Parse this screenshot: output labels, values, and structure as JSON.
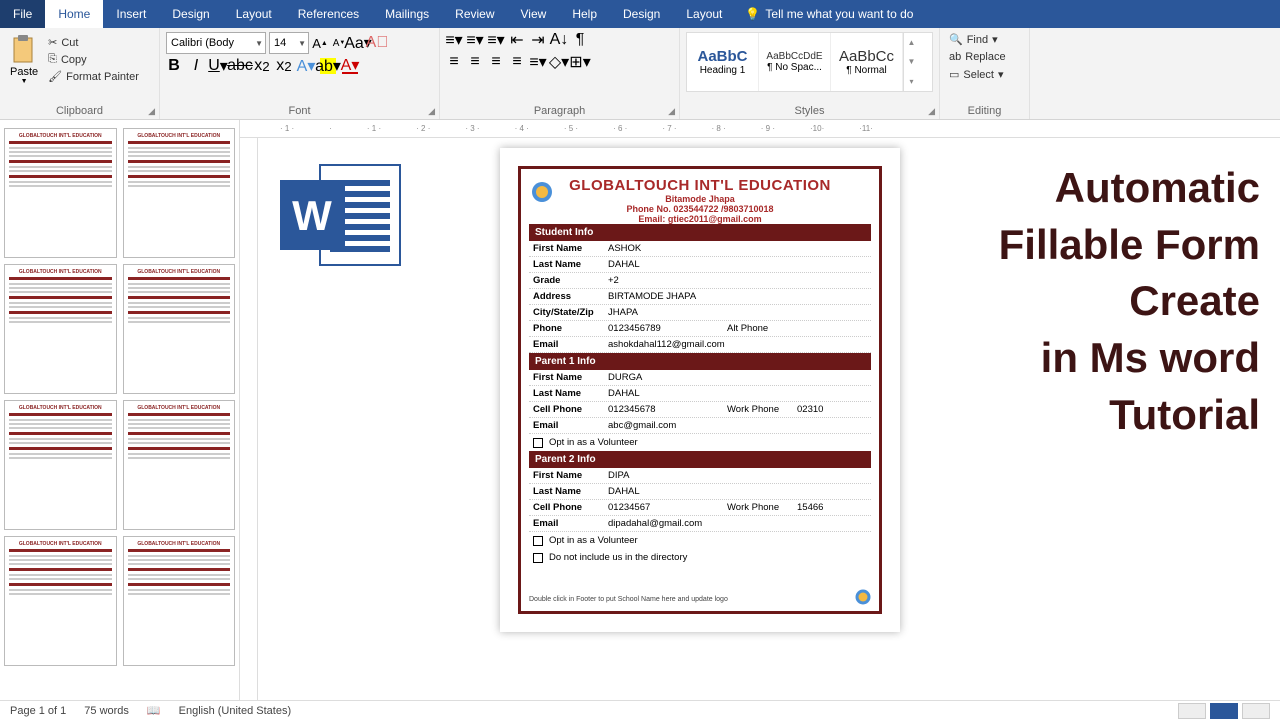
{
  "ribbon": {
    "tabs": [
      "File",
      "Home",
      "Insert",
      "Design",
      "Layout",
      "References",
      "Mailings",
      "Review",
      "View",
      "Help",
      "Design",
      "Layout"
    ],
    "active_tab": "Home",
    "tellme": "Tell me what you want to do",
    "groups": {
      "clipboard": {
        "label": "Clipboard",
        "paste": "Paste",
        "cut": "Cut",
        "copy": "Copy",
        "format_painter": "Format Painter"
      },
      "font": {
        "label": "Font",
        "font_name": "Calibri (Body",
        "font_size": "14"
      },
      "paragraph": {
        "label": "Paragraph"
      },
      "styles": {
        "label": "Styles",
        "items": [
          {
            "preview": "AaBbC",
            "name": "Heading 1"
          },
          {
            "preview": "AaBbCcDdE",
            "name": "¶ No Spac..."
          },
          {
            "preview": "AaBbCc",
            "name": "¶ Normal"
          }
        ]
      },
      "editing": {
        "label": "Editing",
        "find": "Find",
        "replace": "Replace",
        "select": "Select"
      }
    }
  },
  "document": {
    "title": "GLOBALTOUCH INT'L EDUCATION",
    "sub1": "Bitamode Jhapa",
    "sub2": "Phone No. 023544722 /9803710018",
    "sub3": "Email: gtiec2011@gmail.com",
    "sections": {
      "student": {
        "title": "Student Info",
        "rows": [
          {
            "label": "First Name",
            "val": "ASHOK"
          },
          {
            "label": "Last Name",
            "val": "DAHAL"
          },
          {
            "label": "Grade",
            "val": "+2"
          },
          {
            "label": "Address",
            "val": "BIRTAMODE JHAPA"
          },
          {
            "label": "City/State/Zip",
            "val": "JHAPA"
          },
          {
            "label": "Phone",
            "val": "0123456789",
            "label2": "Alt Phone",
            "val2": ""
          },
          {
            "label": "Email",
            "val": "ashokdahal112@gmail.com"
          }
        ]
      },
      "parent1": {
        "title": "Parent 1 Info",
        "rows": [
          {
            "label": "First Name",
            "val": "DURGA"
          },
          {
            "label": "Last Name",
            "val": "DAHAL"
          },
          {
            "label": "Cell Phone",
            "val": "012345678",
            "label2": "Work Phone",
            "val2": "02310"
          },
          {
            "label": "Email",
            "val": "abc@gmail.com"
          }
        ],
        "checkbox": "Opt in as a Volunteer"
      },
      "parent2": {
        "title": "Parent 2 Info",
        "rows": [
          {
            "label": "First Name",
            "val": "DIPA"
          },
          {
            "label": "Last Name",
            "val": "DAHAL"
          },
          {
            "label": "Cell Phone",
            "val": "01234567",
            "label2": "Work Phone",
            "val2": "15466"
          },
          {
            "label": "Email",
            "val": "dipadahal@gmail.com"
          }
        ],
        "checkbox": "Opt in as a Volunteer"
      }
    },
    "directory_checkbox": "Do not include us in the directory",
    "footer_note": "Double click in Footer to put School Name here and update logo"
  },
  "overlay": {
    "line1": "Automatic",
    "line2": "Fillable Form",
    "line3": "Create",
    "line4": "in Ms word",
    "line5": "Tutorial"
  },
  "status": {
    "page": "Page 1 of 1",
    "words": "75 words",
    "language": "English (United States)"
  },
  "ruler_marks": [
    "1",
    "",
    "1",
    "2",
    "3",
    "4",
    "5",
    "6",
    "7",
    "8",
    "9",
    "10",
    "11"
  ]
}
